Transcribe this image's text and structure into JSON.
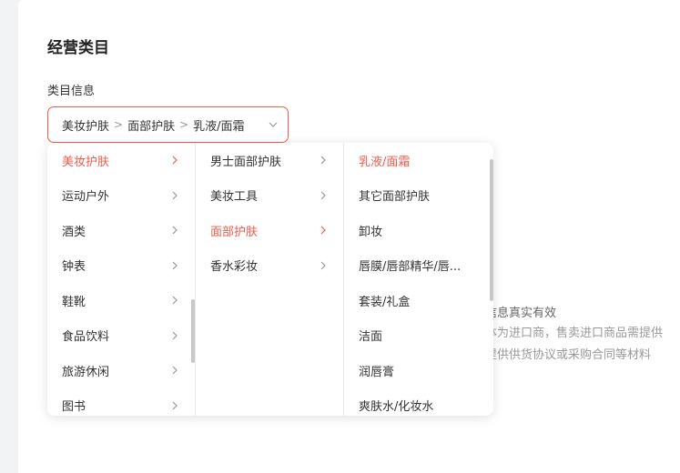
{
  "section_title": "经营类目",
  "field_label": "类目信息",
  "cascader": {
    "path": [
      "美妆护肤",
      "面部护肤",
      "乳液/面霜"
    ],
    "separator": ">"
  },
  "helper_text": [
    "，信息真实有效",
    "主体为进口商，售卖进口商品需提供",
    "需提供供货协议或采购合同等材料"
  ],
  "dropdown": {
    "level1": [
      {
        "label": "美妆护肤",
        "active": true
      },
      {
        "label": "运动户外",
        "active": false
      },
      {
        "label": "酒类",
        "active": false
      },
      {
        "label": "钟表",
        "active": false
      },
      {
        "label": "鞋靴",
        "active": false
      },
      {
        "label": "食品饮料",
        "active": false
      },
      {
        "label": "旅游休闲",
        "active": false
      },
      {
        "label": "图书",
        "active": false
      }
    ],
    "level2": [
      {
        "label": "男士面部护肤",
        "active": false
      },
      {
        "label": "美妆工具",
        "active": false
      },
      {
        "label": "面部护肤",
        "active": true
      },
      {
        "label": "香水彩妆",
        "active": false
      }
    ],
    "level3": [
      {
        "label": "乳液/面霜",
        "active": true
      },
      {
        "label": "其它面部护肤",
        "active": false
      },
      {
        "label": "卸妆",
        "active": false
      },
      {
        "label": "唇膜/唇部精华/唇...",
        "active": false
      },
      {
        "label": "套装/礼盒",
        "active": false
      },
      {
        "label": "洁面",
        "active": false
      },
      {
        "label": "润唇膏",
        "active": false
      },
      {
        "label": "爽肤水/化妆水",
        "active": false
      }
    ]
  },
  "colors": {
    "accent": "#ef5b4d",
    "text": "#333333",
    "muted": "#999999"
  }
}
